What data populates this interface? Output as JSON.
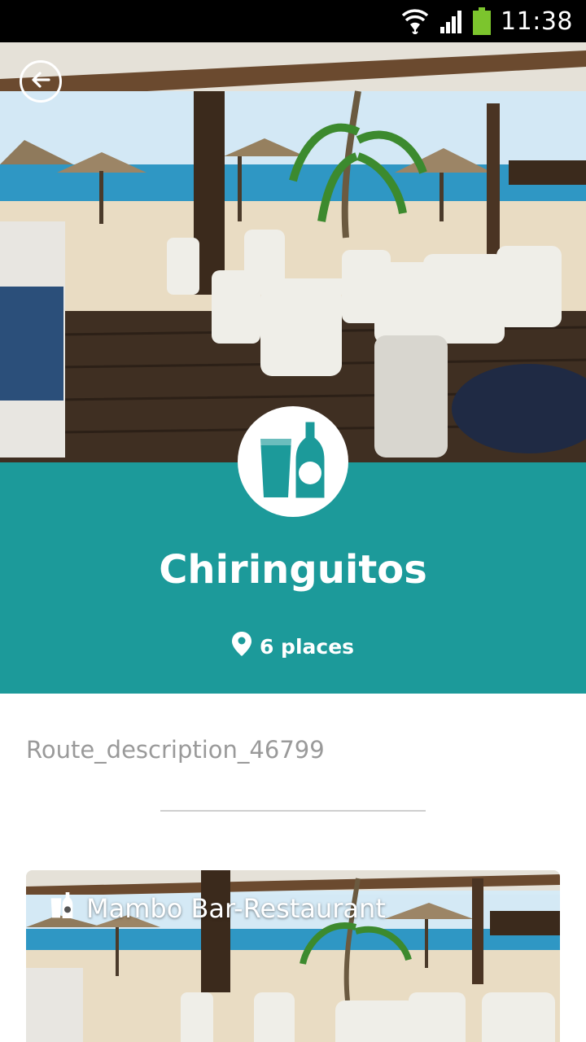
{
  "status_bar": {
    "time": "11:38",
    "icons": [
      "wifi-icon",
      "signal-icon",
      "battery-icon"
    ],
    "battery_color": "#7cc52d"
  },
  "hero": {
    "back_icon": "arrow-left-icon",
    "category_icon": "drinks-icon"
  },
  "header": {
    "title": "Chiringuitos",
    "places_icon": "location-pin-icon",
    "places_text": "6 places",
    "background_color": "#1c9a9a"
  },
  "description": "Route_description_46799",
  "places": [
    {
      "name": "Mambo Bar-Restaurant",
      "icon": "drinks-icon"
    }
  ]
}
